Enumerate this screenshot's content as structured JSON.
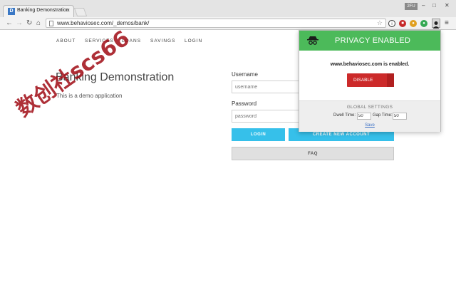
{
  "browser": {
    "tab_title": "Banking Demonstration",
    "tab_favicon": "D",
    "url": "www.behaviosec.com/_demos/bank/",
    "window_badge": "2FU"
  },
  "site": {
    "nav": [
      "ABOUT",
      "SERVICES",
      "LOANS",
      "SAVINGS",
      "LOGIN"
    ],
    "title": "Banking Demonstration",
    "subtitle": "This is a demo application"
  },
  "form": {
    "username_label": "Username",
    "username_placeholder": "username",
    "password_label": "Password",
    "password_placeholder": "password",
    "login_button": "LOGIN",
    "create_button": "CREATE NEW ACCOUNT",
    "faq_button": "FAQ"
  },
  "popup": {
    "title": "PRIVACY ENABLED",
    "domain_status": "www.behaviosec.com is enabled.",
    "disable_button": "DISABLE",
    "settings_title": "GLOBAL SETTINGS",
    "dwell_label": "Dwell Time:",
    "dwell_value": "50",
    "gap_label": "Gap Time:",
    "gap_value": "50",
    "save_link": "Save",
    "accent_color": "#4cba5a"
  },
  "watermark": "数创社scs66"
}
